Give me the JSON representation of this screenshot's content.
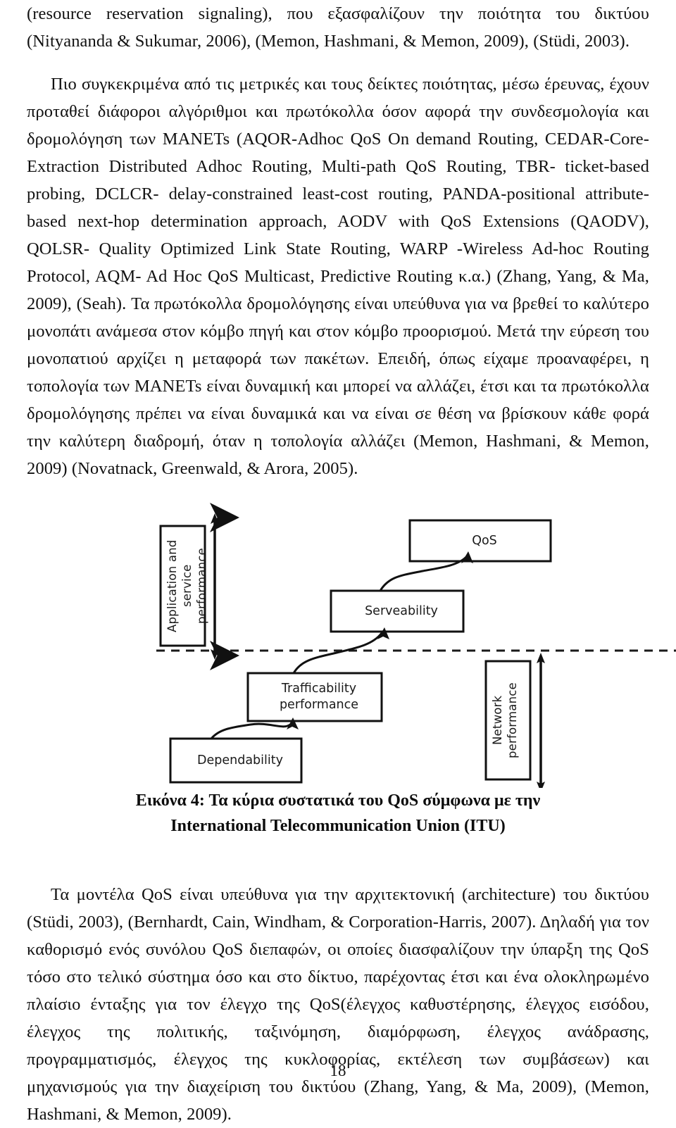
{
  "document": {
    "page_number": "18"
  },
  "body": {
    "paragraph_1": "(resource reservation signaling), που εξασφαλίζουν την ποιότητα του δικτύου  (Nityananda & Sukumar, 2006), (Memon, Hashmani, & Memon, 2009),  (Stüdi, 2003).",
    "paragraph_2": "Πιο συγκεκριμένα από τις μετρικές και τους δείκτες ποιότητας, μέσω έρευνας, έχουν προταθεί διάφοροι αλγόριθμοι και πρωτόκολλα όσον αφορά την συνδεσμολογία και δρομολόγηση των  MANETs (AQOR-Adhoc QoS On demand Routing, CEDAR-Core-Extraction Distributed Adhoc Routing, Multi-path QoS Routing, TBR- ticket-based probing, DCLCR- delay-constrained least-cost routing, PANDA-positional attribute-based next-hop determination approach, AODV with QoS Extensions (QAODV), QOLSR- Quality Optimized Link State Routing, WARP -Wireless Ad-hoc Routing Protocol, AQM- Ad Hoc QoS Multicast, Predictive Routing κ.α.) (Zhang, Yang, & Ma, 2009), (Seah). Τα πρωτόκολλα δρομολόγησης είναι υπεύθυνα για να βρεθεί το καλύτερο μονοπάτι ανάμεσα στον κόμβο πηγή και στον  κόμβο προορισμού. Μετά την εύρεση του μονοπατιού αρχίζει η μεταφορά των πακέτων. Επειδή, όπως είχαμε προαναφέρει, η τοπολογία των MANETs είναι δυναμική και μπορεί να αλλάζει, έτσι και τα πρωτόκολλα δρομολόγησης πρέπει να είναι δυναμικά και να είναι σε θέση να βρίσκουν κάθε φορά την καλύτερη διαδρομή, όταν η τοπολογία αλλάζει (Memon, Hashmani, & Memon, 2009) (Novatnack, Greenwald, & Arora, 2005).",
    "paragraph_3": "Τα μοντέλα QoS είναι υπεύθυνα για την αρχιτεκτονική (architecture) του δικτύου  (Stüdi, 2003), (Bernhardt, Cain, Windham, & Corporation-Harris, 2007). Δηλαδή για τον καθορισμό ενός συνόλου QoS διεπαφών, οι οποίες διασφαλίζουν την ύπαρξη της QoS  τόσο στο τελικό σύστημα όσο και στο δίκτυο, παρέχοντας έτσι  και  ένα ολοκληρωμένο πλαίσιο ένταξης για τον έλεγχο της QoS(έλεγχος καθυστέρησης, έλεγχος εισόδου, έλεγχος της πολιτικής, ταξινόμηση, διαμόρφωση, έλεγχος ανάδρασης, προγραμματισμός, έλεγχος της κυκλοφορίας, εκτέλεση των συμβάσεων) και μηχανισμούς για την διαχείριση του δικτύου (Zhang, Yang, & Ma, 2009),  (Memon, Hashmani, & Memon, 2009)."
  },
  "figure": {
    "caption_line_1": "Εικόνα 4: Τα κύρια συστατικά του QoS σύμφωνα με την International",
    "caption_line_2": "Telecommunication Union (ITU)",
    "nodes": {
      "qos": "QoS",
      "serveability": "Serveability",
      "trafficability": "Trafficability\nperformance",
      "dependability": "Dependability",
      "application_scope": "Application and\nservice\nperformance",
      "network_scope": "Network\nperformance"
    },
    "colors": {
      "stroke": "#111111",
      "fill": "#ffffff",
      "divider": "#1a1a1a"
    }
  }
}
